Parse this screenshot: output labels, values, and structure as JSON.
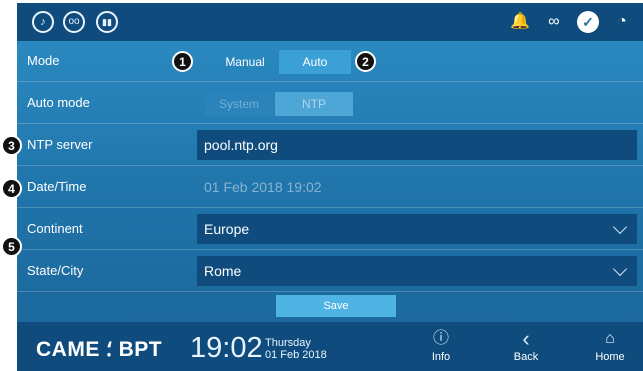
{
  "topbar": {
    "left_icons": [
      {
        "name": "mute-icon",
        "glyph": "♪"
      },
      {
        "name": "voicemail-icon",
        "glyph": "oo"
      },
      {
        "name": "doorbell-icon",
        "glyph": "▮▮"
      }
    ],
    "status_icons": [
      {
        "name": "bell-icon",
        "glyph": "🔔"
      },
      {
        "name": "link-icon",
        "glyph": "∞"
      },
      {
        "name": "check-icon",
        "glyph": "✓"
      },
      {
        "name": "wifi-icon",
        "glyph": "◔"
      }
    ]
  },
  "settings": {
    "mode": {
      "label": "Mode",
      "options": [
        "Manual",
        "Auto"
      ],
      "selected": "Auto"
    },
    "auto_mode": {
      "label": "Auto mode",
      "options": [
        "System",
        "NTP"
      ],
      "selected": "NTP"
    },
    "ntp_server": {
      "label": "NTP server",
      "value": "pool.ntp.org"
    },
    "date_time": {
      "label": "Date/Time",
      "value": "01 Feb 2018 19:02"
    },
    "continent": {
      "label": "Continent",
      "value": "Europe"
    },
    "state_city": {
      "label": "State/City",
      "value": "Rome"
    },
    "save_label": "Save"
  },
  "callouts": [
    "1",
    "2",
    "3",
    "4",
    "5"
  ],
  "bottombar": {
    "logo": "CAME ⸵ BPT",
    "time": "19:02",
    "day": "Thursday",
    "date": "01 Feb 2018",
    "nav": [
      {
        "label": "Info",
        "icon": "info-icon",
        "glyph": "ⓘ"
      },
      {
        "label": "Back",
        "icon": "back-icon",
        "glyph": "‹"
      },
      {
        "label": "Home",
        "icon": "home-icon",
        "glyph": "⌂"
      }
    ]
  },
  "colors": {
    "panel": "#2d8ec6",
    "bar": "#0f4c7d",
    "input_fill": "#0f4c7d",
    "selected_toggle": "#3ba0d7",
    "disabled_toggle": "#4ea6d6",
    "save_button": "#4fb3e3"
  }
}
